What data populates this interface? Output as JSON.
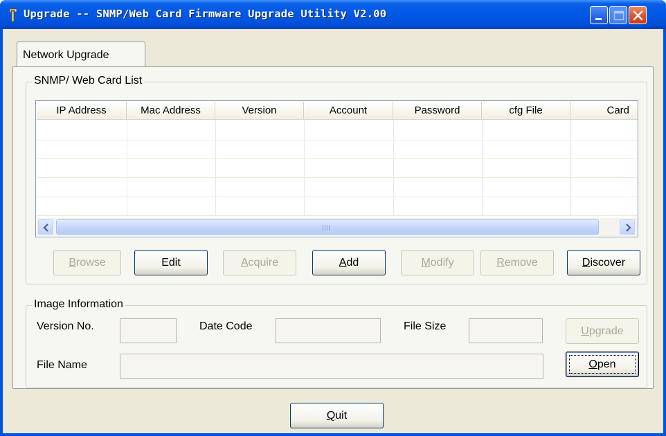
{
  "window": {
    "title": "Upgrade -- SNMP/Web Card Firmware Upgrade Utility V2.00"
  },
  "tabs": [
    {
      "label": "Network Upgrade",
      "selected": true
    }
  ],
  "card_list": {
    "group_label": "SNMP/ Web Card List",
    "columns": [
      "IP Address",
      "Mac Address",
      "Version",
      "Account",
      "Password",
      "cfg File",
      "Card"
    ],
    "rows": []
  },
  "buttons": {
    "browse": {
      "label": "Browse",
      "mnemonic": "B",
      "rest": "rowse",
      "enabled": false
    },
    "edit": {
      "label": "Edit",
      "enabled": true
    },
    "acquire": {
      "label": "Acquire",
      "mnemonic": "A",
      "rest": "cquire",
      "enabled": false
    },
    "add": {
      "label": "Add",
      "mnemonic": "A",
      "rest": "dd",
      "enabled": true
    },
    "modify": {
      "label": "Modify",
      "mnemonic": "M",
      "rest": "odify",
      "enabled": false
    },
    "remove": {
      "label": "Remove",
      "mnemonic": "R",
      "rest": "emove",
      "enabled": false
    },
    "discover": {
      "label": "Discover",
      "mnemonic": "D",
      "rest": "iscover",
      "enabled": true
    },
    "upgrade": {
      "label": "Upgrade",
      "mnemonic": "U",
      "rest": "pgrade",
      "enabled": false
    },
    "open": {
      "label": "Open",
      "mnemonic": "O",
      "rest": "pen",
      "enabled": true
    },
    "quit": {
      "label": "Quit",
      "mnemonic": "Q",
      "rest": "uit",
      "enabled": true
    }
  },
  "image_info": {
    "group_label": "Image Information",
    "version_label": "Version No.",
    "version_value": "",
    "date_label": "Date Code",
    "date_value": "",
    "size_label": "File Size",
    "size_value": "",
    "filename_label": "File Name",
    "filename_value": ""
  },
  "colors": {
    "title_bar": "#0058e6",
    "dialog_face": "#ece9d8",
    "tab_face": "#f7f7f1",
    "close_button": "#e0512a",
    "disabled_text": "#aca899"
  },
  "icons": [
    "app-icon",
    "minimize-icon",
    "maximize-icon",
    "close-icon",
    "scroll-left-icon",
    "scroll-right-icon"
  ]
}
